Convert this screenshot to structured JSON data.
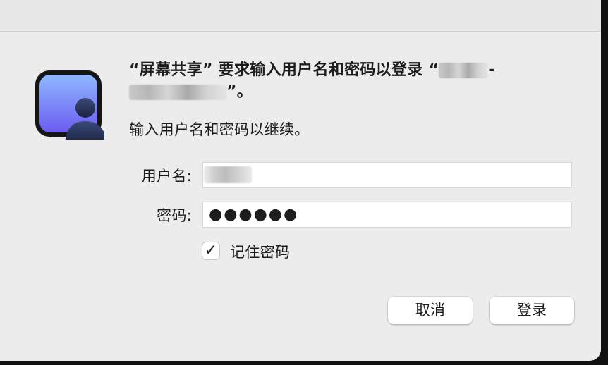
{
  "dialog": {
    "app_icon": "screen-sharing-person-icon",
    "title_prefix": "“屏幕共享” 要求输入用户名和密码以登录 “",
    "title_suffix": "”。",
    "subtitle": "输入用户名和密码以继续。",
    "username_label": "用户名:",
    "username_value": "",
    "password_label": "密码:",
    "password_value": "●●●●●●",
    "remember_label": "记住密码",
    "remember_checked": true,
    "remember_glyph": "✓",
    "cancel_label": "取消",
    "login_label": "登录"
  }
}
